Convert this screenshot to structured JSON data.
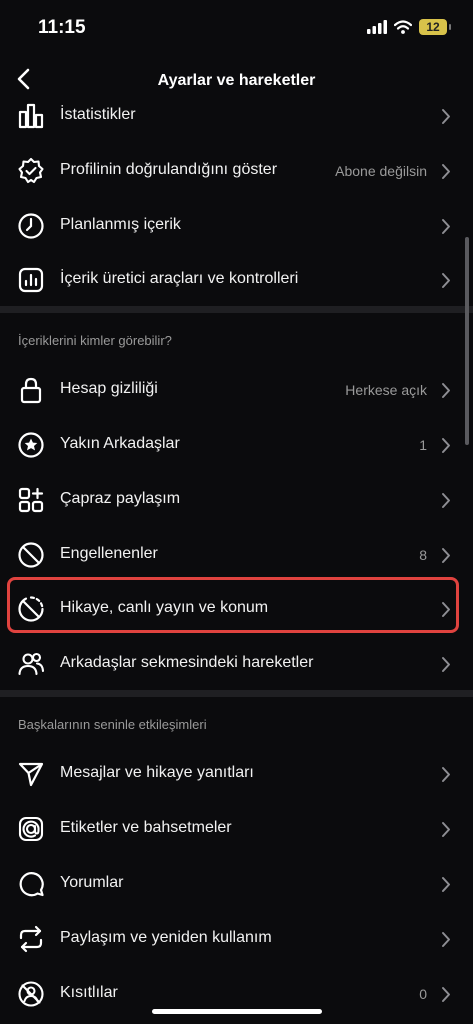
{
  "status": {
    "time": "11:15",
    "battery": "12"
  },
  "header": {
    "title": "Ayarlar ve hareketler"
  },
  "sections": {
    "who_can_see": "İçeriklerini kimler görebilir?",
    "interactions": "Başkalarının seninle etkileşimleri"
  },
  "rows": [
    {
      "id": "stats",
      "label": "İstatistikler",
      "value": "",
      "icon": "bar-chart-icon"
    },
    {
      "id": "verified",
      "label": "Profilinin doğrulandığını göster",
      "value": "Abone değilsin",
      "icon": "verified-badge-icon"
    },
    {
      "id": "scheduled",
      "label": "Planlanmış içerik",
      "value": "",
      "icon": "clock-icon"
    },
    {
      "id": "creator",
      "label": "İçerik üretici araçları ve kontrolleri",
      "value": "",
      "icon": "creator-chart-icon"
    },
    {
      "id": "privacy",
      "label": "Hesap gizliliği",
      "value": "Herkese açık",
      "icon": "lock-icon"
    },
    {
      "id": "close-friends",
      "label": "Yakın Arkadaşlar",
      "value": "1",
      "icon": "star-circle-icon"
    },
    {
      "id": "crossposting",
      "label": "Çapraz paylaşım",
      "value": "",
      "icon": "grid-plus-icon"
    },
    {
      "id": "blocked",
      "label": "Engellenenler",
      "value": "8",
      "icon": "block-icon"
    },
    {
      "id": "story-live",
      "label": "Hikaye, canlı yayın ve konum",
      "value": "",
      "icon": "story-off-icon"
    },
    {
      "id": "friends-tab",
      "label": "Arkadaşlar sekmesindeki hareketler",
      "value": "",
      "icon": "people-icon"
    },
    {
      "id": "messages",
      "label": "Mesajlar ve hikaye yanıtları",
      "value": "",
      "icon": "send-icon"
    },
    {
      "id": "tags",
      "label": "Etiketler ve bahsetmeler",
      "value": "",
      "icon": "at-icon"
    },
    {
      "id": "comments",
      "label": "Yorumlar",
      "value": "",
      "icon": "comment-icon"
    },
    {
      "id": "sharing",
      "label": "Paylaşım ve yeniden kullanım",
      "value": "",
      "icon": "repost-icon"
    },
    {
      "id": "restricted",
      "label": "Kısıtlılar",
      "value": "0",
      "icon": "restricted-icon"
    }
  ]
}
